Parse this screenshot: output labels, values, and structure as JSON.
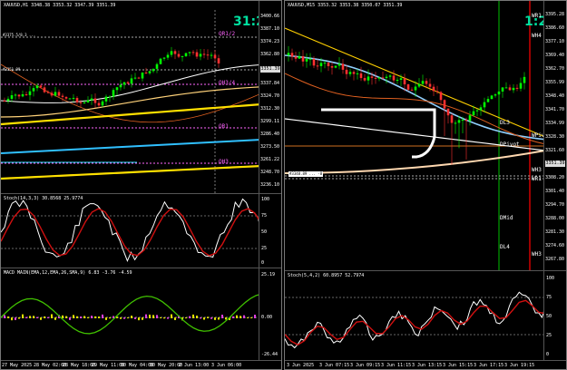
{
  "left_window": {
    "main": {
      "title": "XAUUSD,H1  3348.38 3353.32 3347.39 3351.39",
      "timer": "31:23",
      "levels": [
        {
          "label": "QR1/2",
          "color": "#ff66ff"
        },
        {
          "label": "QH3/4",
          "color": "#ff66ff"
        },
        {
          "label": "QR1",
          "color": "#ff66ff"
        },
        {
          "label": "QH3",
          "color": "#ff66ff"
        }
      ],
      "left_tags": [
        "#3375.5/8.3 ...",
        "#3351.99 ..."
      ],
      "y_ticks": [
        "3400.66",
        "3387.10",
        "3374.23",
        "3362.80",
        "3351.39",
        "3337.84",
        "3324.70",
        "3312.30",
        "3299.11",
        "3286.40",
        "3273.50",
        "3261.22",
        "3248.70",
        "3236.10"
      ],
      "price_marker": "3351.39"
    },
    "stoch": {
      "title": "Stoch(14,3,3) 30.8568 25.9774",
      "y_ticks": [
        "100",
        "75",
        "50",
        "25",
        "0"
      ]
    },
    "macd": {
      "title": "MACD MAIN(EMA,12,EMA,26,SMA,9) 6.83 -3.76 -4.59",
      "y_ticks": [
        "25.19",
        "0.00",
        "-26.44"
      ]
    },
    "x_ticks": [
      "27 May 2025",
      "28 May 02:00",
      "28 May 18:00",
      "29 May 11:00",
      "30 May 04:00",
      "30 May 20:00",
      "2 Jun 13:00",
      "3 Jun 06:00"
    ]
  },
  "right_window": {
    "main": {
      "title": "XAUUSD,M15  3353.32 3353.38 3350.07 3351.39",
      "timer": "1:23",
      "levels": [
        {
          "label": "WR1",
          "color": "#ffffff"
        },
        {
          "label": "WH4",
          "color": "#ffffff"
        },
        {
          "label": "DL3",
          "color": "#ffffff"
        },
        {
          "label": "DPivot",
          "color": "#ffffff"
        },
        {
          "label": "WPiv",
          "color": "#ffffff"
        },
        {
          "label": "WH3",
          "color": "#ffffff"
        },
        {
          "label": "WR1",
          "color": "#ffffff"
        },
        {
          "label": "DMid",
          "color": "#ffffff"
        },
        {
          "label": "DL4",
          "color": "#ffffff"
        },
        {
          "label": "WH3",
          "color": "#ffffff"
        }
      ],
      "left_tag": "#3348.89 ... -8",
      "y_ticks": [
        "3395.28",
        "3386.60",
        "3377.10",
        "3369.40",
        "3362.70",
        "3355.99",
        "3348.40",
        "3341.70",
        "3334.99",
        "3328.30",
        "3321.60",
        "3314.90",
        "3308.20",
        "3301.40",
        "3294.70",
        "3288.00",
        "3281.30",
        "3274.60",
        "3267.80"
      ],
      "price_marker": "3351.39"
    },
    "stoch": {
      "title": "Stoch(5,4,2) 60.8957 52.7974",
      "y_ticks": [
        "100",
        "75",
        "50",
        "25",
        "0"
      ]
    },
    "x_ticks": [
      "3 Jun 2025",
      "3 Jun 07:15",
      "3 Jun 09:15",
      "3 Jun 11:15",
      "3 Jun 13:15",
      "3 Jun 15:15",
      "3 Jun 17:15",
      "3 Jun 19:15"
    ]
  }
}
